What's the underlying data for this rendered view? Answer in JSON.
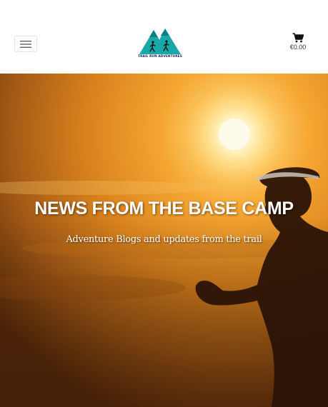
{
  "header": {
    "menu_icon": "hamburger-menu-icon",
    "logo_text": "TRAIL RUN ADVENTURES",
    "cart_icon": "shopping-cart-icon",
    "cart_total": "€0.00"
  },
  "hero": {
    "title": "NEWS FROM THE BASE CAMP",
    "subtitle": "Adventure Blogs and updates from the trail"
  },
  "colors": {
    "logo_teal": "#1aa7a7",
    "logo_navy": "#1a2a66",
    "sky_bright": "#f6a62c",
    "sky_dark": "#7a3a0c"
  }
}
